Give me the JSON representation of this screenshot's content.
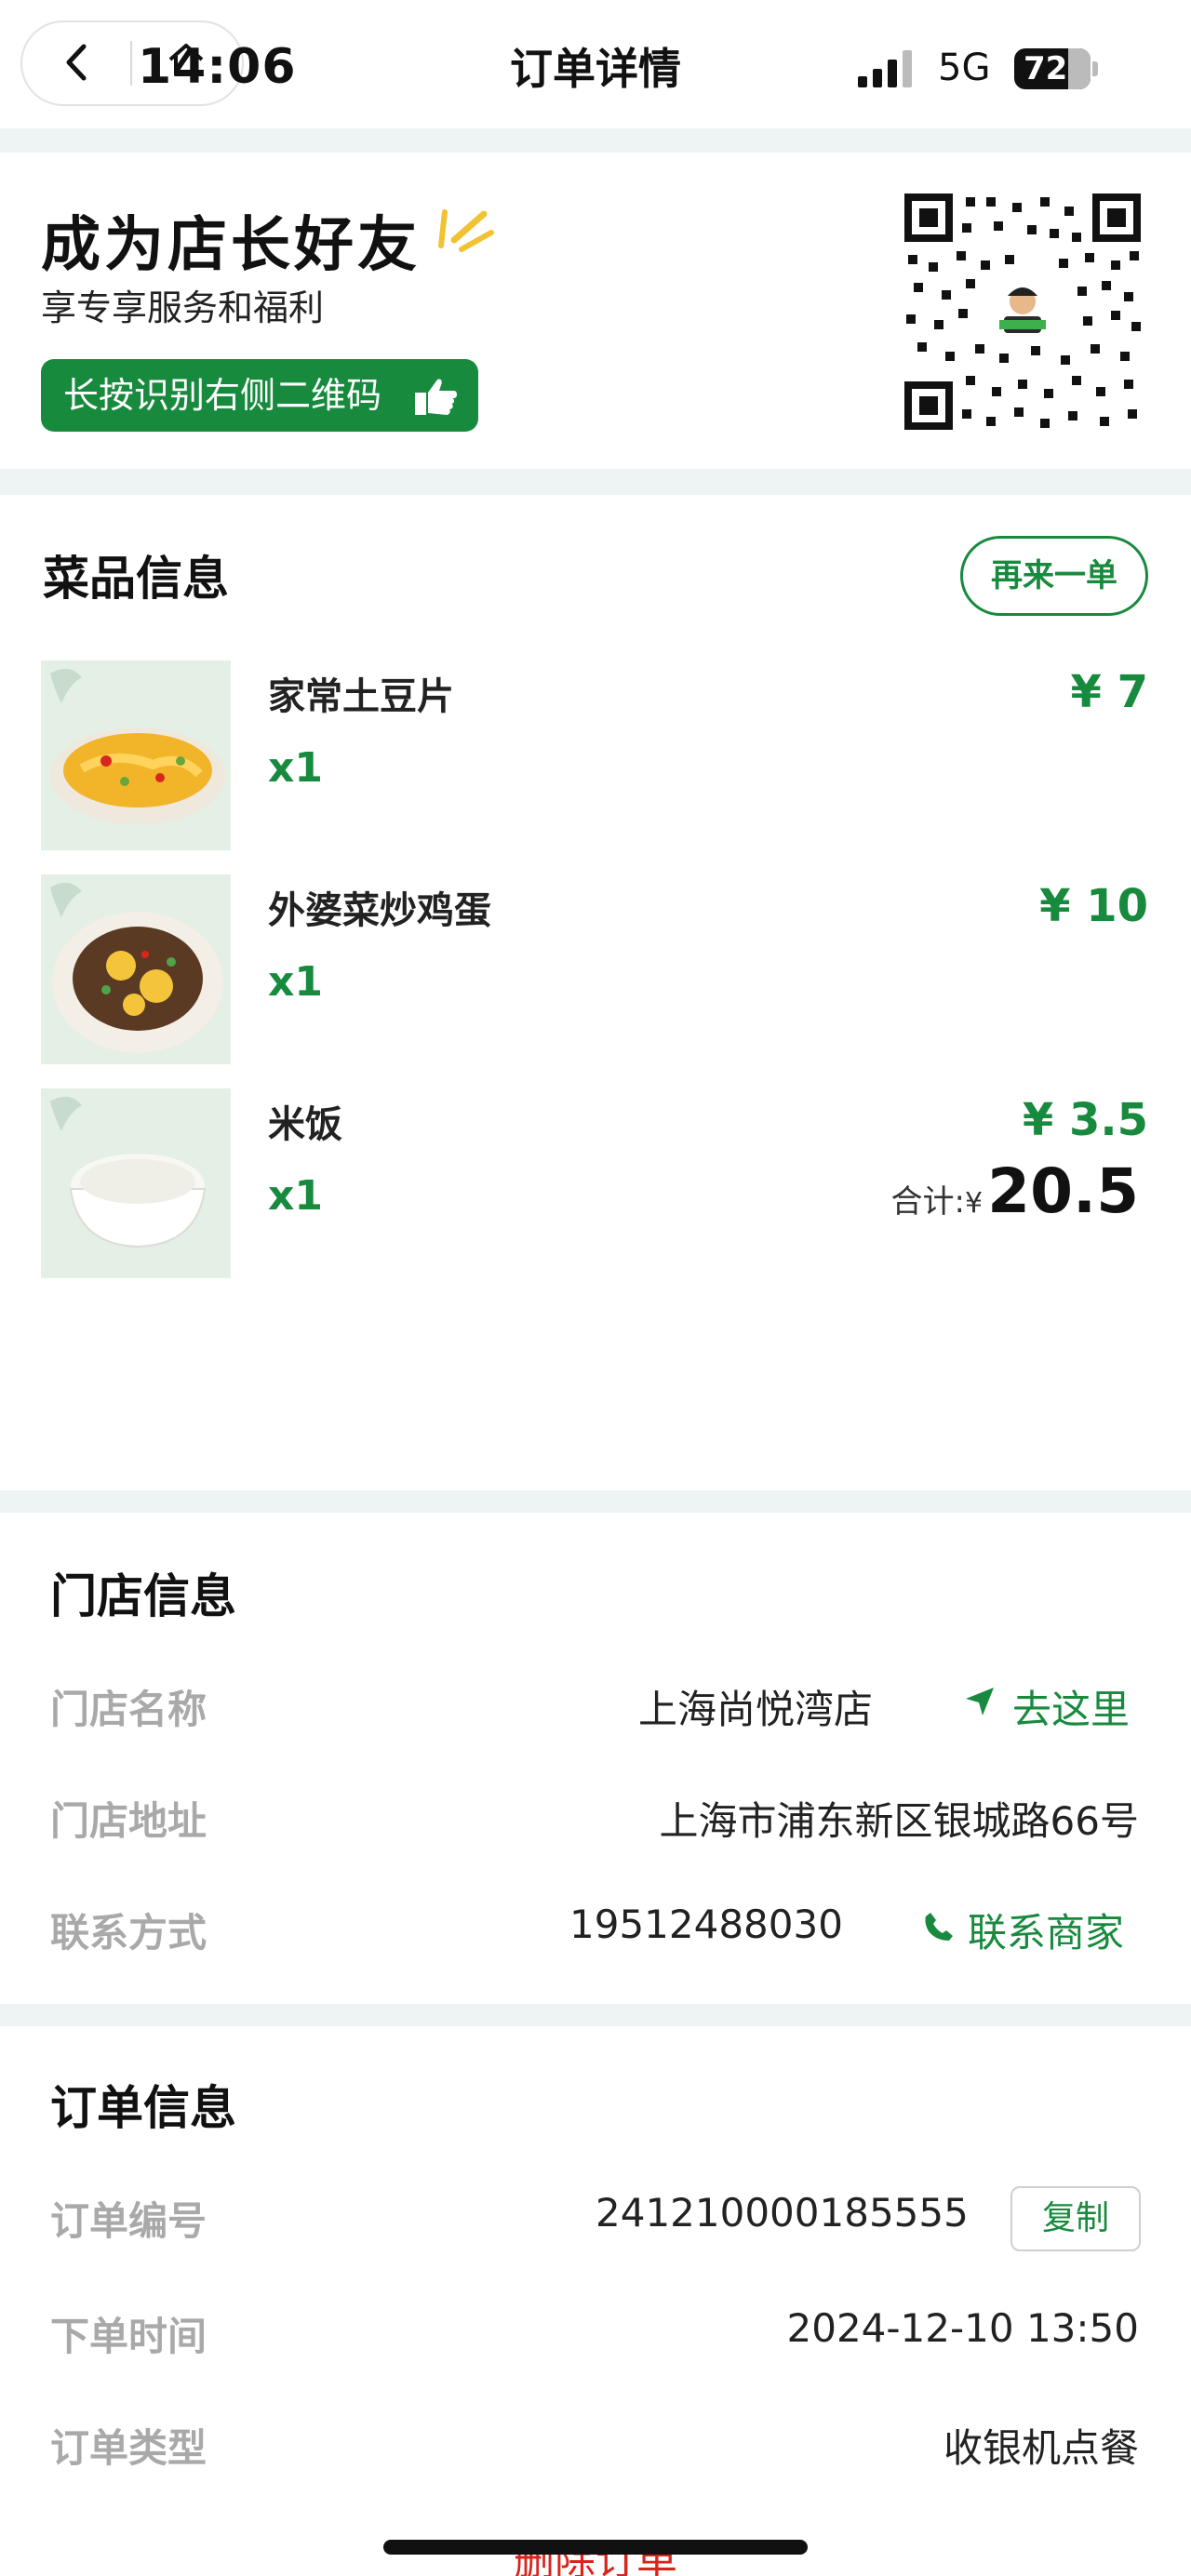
{
  "status_bar": {
    "time": "14:06",
    "network": "5G",
    "battery": "72"
  },
  "nav": {
    "title": "订单详情"
  },
  "promo": {
    "title": "成为店长好友",
    "subtitle": "享专享服务和福利",
    "button_label": "长按识别右侧二维码"
  },
  "dishes": {
    "title": "菜品信息",
    "reorder_label": "再来一单",
    "items": [
      {
        "name": "家常土豆片",
        "qty": "x1",
        "price": "¥ 7"
      },
      {
        "name": "外婆菜炒鸡蛋",
        "qty": "x1",
        "price": "¥ 10"
      },
      {
        "name": "米饭",
        "qty": "x1",
        "price": "¥ 3.5"
      }
    ],
    "total_label": "合计:",
    "total_currency": "¥",
    "total_value": "20.5"
  },
  "store": {
    "title": "门店信息",
    "name_label": "门店名称",
    "name_value": "上海尚悦湾店",
    "go_label": "去这里",
    "address_label": "门店地址",
    "address_value": "上海市浦东新区银城路66号",
    "contact_label": "联系方式",
    "contact_value": "19512488030",
    "call_label": "联系商家"
  },
  "order": {
    "title": "订单信息",
    "number_label": "订单编号",
    "number_value": "241210000185555",
    "copy_label": "复制",
    "time_label": "下单时间",
    "time_value": "2024-12-10 13:50",
    "type_label": "订单类型",
    "type_value": "收银机点餐",
    "delete_label": "删除订单"
  },
  "colors": {
    "brand_green": "#178a3e",
    "delete_red": "#d9241c",
    "label_gray": "#a9a9a9",
    "background": "#eef4f4"
  }
}
